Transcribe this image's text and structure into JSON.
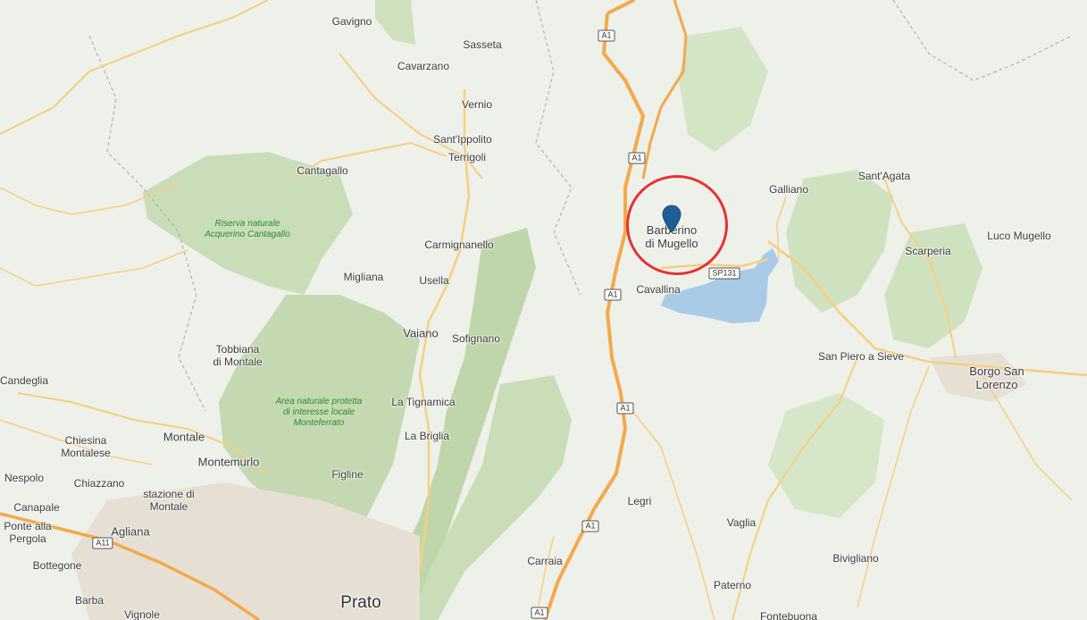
{
  "map": {
    "colors": {
      "land": "#eef0ea",
      "forest": "#cfe0bf",
      "forest_dark": "#b9d3a8",
      "lake": "#a9cbe8",
      "motorway": "#f4a94b",
      "road": "#f6cf7e",
      "minor_road": "#ffffff",
      "boundary": "#a9a9a9",
      "urban": "#e3ddd2",
      "highlight_ring": "#e53232",
      "marker": "#1d5e96"
    },
    "selected_place": "Barberino\ndi Mugello",
    "places": [
      {
        "key": "gavigno",
        "label": "Gavigno"
      },
      {
        "key": "sasseta",
        "label": "Sasseta"
      },
      {
        "key": "cavarzano",
        "label": "Cavarzano"
      },
      {
        "key": "vernio",
        "label": "Vernio"
      },
      {
        "key": "santippolito",
        "label": "Sant'Ippolito"
      },
      {
        "key": "terrigoli",
        "label": "Terrigoli"
      },
      {
        "key": "cantagallo",
        "label": "Cantagallo"
      },
      {
        "key": "carmignanello",
        "label": "Carmignanello"
      },
      {
        "key": "migliana",
        "label": "Migliana"
      },
      {
        "key": "usella",
        "label": "Usella"
      },
      {
        "key": "vaiano",
        "label": "Vaiano"
      },
      {
        "key": "sofignano",
        "label": "Sofignano"
      },
      {
        "key": "tobbiana",
        "label": "Tobbiana\ndi Montale"
      },
      {
        "key": "candeglia",
        "label": "Candeglia"
      },
      {
        "key": "latignamica",
        "label": "La Tignamica"
      },
      {
        "key": "labriglia",
        "label": "La Briglia"
      },
      {
        "key": "montale",
        "label": "Montale"
      },
      {
        "key": "chiesina",
        "label": "Chiesina\nMontalese"
      },
      {
        "key": "montemurlo",
        "label": "Montemurlo"
      },
      {
        "key": "figline",
        "label": "Figline"
      },
      {
        "key": "nespolo",
        "label": "Nespolo"
      },
      {
        "key": "chiazzano",
        "label": "Chiazzano"
      },
      {
        "key": "stazione",
        "label": "stazione di\nMontale"
      },
      {
        "key": "canapale",
        "label": "Canapale"
      },
      {
        "key": "agliana",
        "label": "Agliana"
      },
      {
        "key": "ponte",
        "label": "Ponte alla\nPergola"
      },
      {
        "key": "bottegone",
        "label": "Bottegone"
      },
      {
        "key": "barba",
        "label": "Barba"
      },
      {
        "key": "vignole",
        "label": "Vignole"
      },
      {
        "key": "prato",
        "label": "Prato"
      },
      {
        "key": "carraia",
        "label": "Carraia"
      },
      {
        "key": "legri",
        "label": "Legri"
      },
      {
        "key": "cavallina",
        "label": "Cavallina"
      },
      {
        "key": "galliano",
        "label": "Galliano"
      },
      {
        "key": "santagata",
        "label": "Sant'Agata"
      },
      {
        "key": "scarperia",
        "label": "Scarperia"
      },
      {
        "key": "lucomugello",
        "label": "Luco Mugello"
      },
      {
        "key": "sanpiero",
        "label": "San Piero a Sieve"
      },
      {
        "key": "borgo",
        "label": "Borgo San\nLorenzo"
      },
      {
        "key": "vaglia",
        "label": "Vaglia"
      },
      {
        "key": "bivigliano",
        "label": "Bivigliano"
      },
      {
        "key": "paterno",
        "label": "Paterno"
      },
      {
        "key": "fontebuona",
        "label": "Fontebuona"
      }
    ],
    "parks": [
      {
        "key": "acquerino",
        "label": "Riserva naturale\nAcquerino Cantagallo"
      },
      {
        "key": "monteferrato",
        "label": "Area naturale protetta\ndi interesse locale\nMonteferrato"
      }
    ],
    "road_shields": [
      {
        "key": "a1_1",
        "label": "A1"
      },
      {
        "key": "a1_2",
        "label": "A1"
      },
      {
        "key": "a1_3",
        "label": "A1"
      },
      {
        "key": "a1_4",
        "label": "A1"
      },
      {
        "key": "a1_5",
        "label": "A1"
      },
      {
        "key": "a1_6",
        "label": "A1"
      },
      {
        "key": "sp131",
        "label": "SP131"
      },
      {
        "key": "a11",
        "label": "A11"
      }
    ]
  }
}
